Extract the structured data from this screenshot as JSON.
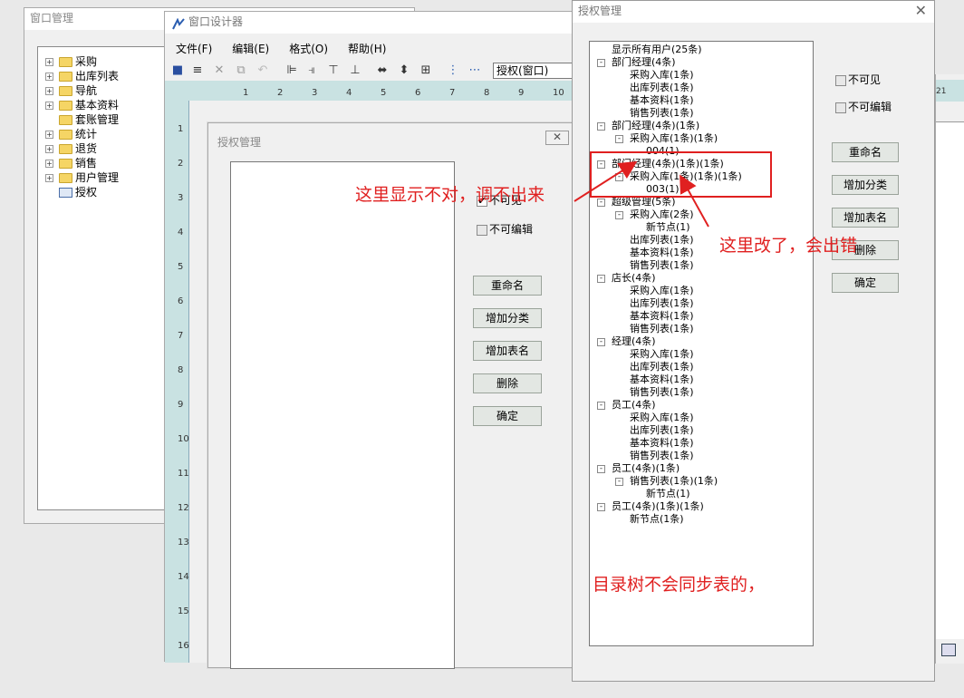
{
  "window_manager": {
    "title": "窗口管理",
    "tree": [
      {
        "label": "采购",
        "icon": "folder"
      },
      {
        "label": "出库列表",
        "icon": "folder"
      },
      {
        "label": "导航",
        "icon": "folder"
      },
      {
        "label": "基本资料",
        "icon": "folder"
      },
      {
        "label": "套账管理",
        "icon": "folder"
      },
      {
        "label": "统计",
        "icon": "folder"
      },
      {
        "label": "退货",
        "icon": "folder"
      },
      {
        "label": "销售",
        "icon": "folder"
      },
      {
        "label": "用户管理",
        "icon": "folder"
      },
      {
        "label": "授权",
        "icon": "form"
      }
    ]
  },
  "designer": {
    "title": "窗口设计器",
    "menu": [
      "文件(F)",
      "编辑(E)",
      "格式(O)",
      "帮助(H)"
    ],
    "toolbar_select_value": "授权(窗口)",
    "ruler_top": [
      "1",
      "2",
      "3",
      "4",
      "5",
      "6",
      "7",
      "8",
      "9",
      "10"
    ],
    "ruler_left": [
      "1",
      "2",
      "3",
      "4",
      "5",
      "6",
      "7",
      "8",
      "9",
      "10",
      "11",
      "12",
      "13",
      "14",
      "15",
      "16"
    ],
    "form": {
      "title": "授权管理",
      "checkbox_invisible": "不可见",
      "checkbox_noedit": "不可编辑",
      "buttons": [
        "重命名",
        "增加分类",
        "增加表名",
        "删除",
        "确定"
      ]
    }
  },
  "auth_dialog": {
    "title": "授权管理",
    "checkbox_invisible": "不可见",
    "checkbox_noedit": "不可编辑",
    "buttons": [
      "重命名",
      "增加分类",
      "增加表名",
      "删除",
      "确定"
    ],
    "tree": [
      {
        "label": "显示所有用户(25条)",
        "level": 0,
        "box": ""
      },
      {
        "label": "部门经理(4条)",
        "level": 0,
        "box": "-"
      },
      {
        "label": "采购入库(1条)",
        "level": 1,
        "box": ""
      },
      {
        "label": "出库列表(1条)",
        "level": 1,
        "box": ""
      },
      {
        "label": "基本资料(1条)",
        "level": 1,
        "box": ""
      },
      {
        "label": "销售列表(1条)",
        "level": 1,
        "box": ""
      },
      {
        "label": "部门经理(4条)(1条)",
        "level": 0,
        "box": "-"
      },
      {
        "label": "采购入库(1条)(1条)",
        "level": 1,
        "box": "-"
      },
      {
        "label": "004(1)",
        "level": 2,
        "box": ""
      },
      {
        "label": "部门经理(4条)(1条)(1条)",
        "level": 0,
        "box": "-"
      },
      {
        "label": "采购入库(1条)(1条)(1条)",
        "level": 1,
        "box": "-"
      },
      {
        "label": "003(1)",
        "level": 2,
        "box": ""
      },
      {
        "label": "超级管理(5条)",
        "level": 0,
        "box": "-"
      },
      {
        "label": "采购入库(2条)",
        "level": 1,
        "box": "-"
      },
      {
        "label": "新节点(1)",
        "level": 2,
        "box": ""
      },
      {
        "label": "出库列表(1条)",
        "level": 1,
        "box": ""
      },
      {
        "label": "基本资料(1条)",
        "level": 1,
        "box": ""
      },
      {
        "label": "销售列表(1条)",
        "level": 1,
        "box": ""
      },
      {
        "label": "店长(4条)",
        "level": 0,
        "box": "-"
      },
      {
        "label": "采购入库(1条)",
        "level": 1,
        "box": ""
      },
      {
        "label": "出库列表(1条)",
        "level": 1,
        "box": ""
      },
      {
        "label": "基本资料(1条)",
        "level": 1,
        "box": ""
      },
      {
        "label": "销售列表(1条)",
        "level": 1,
        "box": ""
      },
      {
        "label": "经理(4条)",
        "level": 0,
        "box": "-"
      },
      {
        "label": "采购入库(1条)",
        "level": 1,
        "box": ""
      },
      {
        "label": "出库列表(1条)",
        "level": 1,
        "box": ""
      },
      {
        "label": "基本资料(1条)",
        "level": 1,
        "box": ""
      },
      {
        "label": "销售列表(1条)",
        "level": 1,
        "box": ""
      },
      {
        "label": "员工(4条)",
        "level": 0,
        "box": "-"
      },
      {
        "label": "采购入库(1条)",
        "level": 1,
        "box": ""
      },
      {
        "label": "出库列表(1条)",
        "level": 1,
        "box": ""
      },
      {
        "label": "基本资料(1条)",
        "level": 1,
        "box": ""
      },
      {
        "label": "销售列表(1条)",
        "level": 1,
        "box": ""
      },
      {
        "label": "员工(4条)(1条)",
        "level": 0,
        "box": "-"
      },
      {
        "label": "销售列表(1条)(1条)",
        "level": 1,
        "box": "-"
      },
      {
        "label": "新节点(1)",
        "level": 2,
        "box": ""
      },
      {
        "label": "员工(4条)(1条)(1条)",
        "level": 0,
        "box": "-"
      },
      {
        "label": "新节点(1条)",
        "level": 1,
        "box": ""
      }
    ]
  },
  "annotations": {
    "left_note": "这里显示不对，调不出来",
    "right_note": "这里改了，会出错",
    "bottom_note": "目录树不会同步表的，",
    "color": "#e02020"
  },
  "background_ruler_right": "21"
}
